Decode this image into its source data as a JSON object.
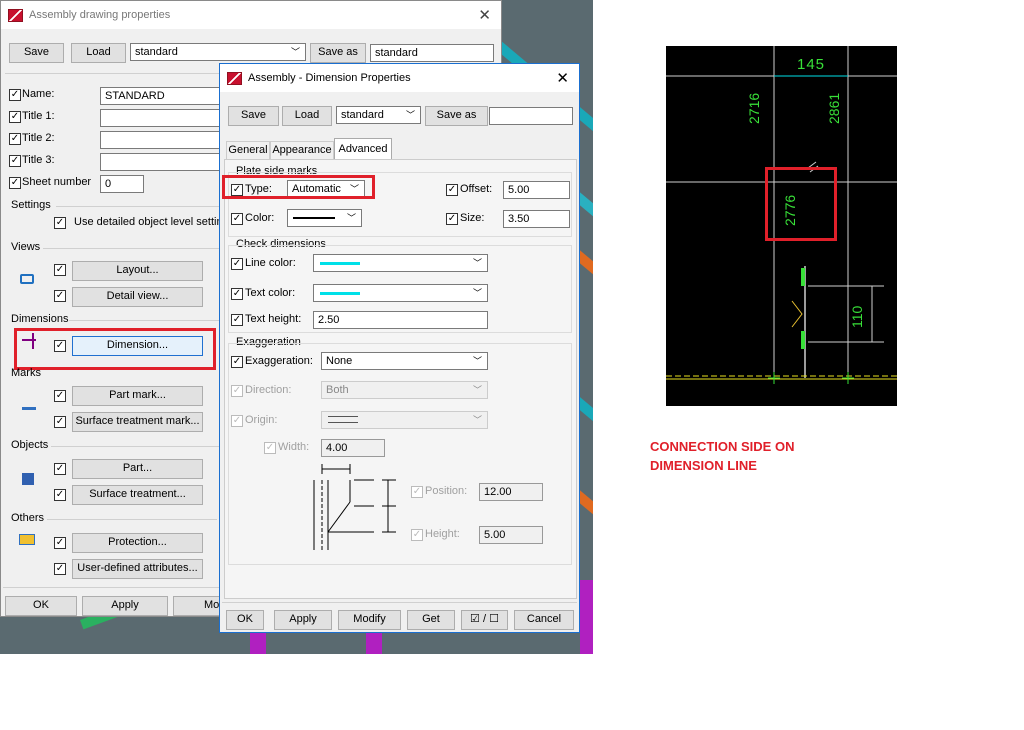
{
  "assembly_dialog": {
    "title": "Assembly drawing properties",
    "save_label": "Save",
    "load_label": "Load",
    "load_value": "standard",
    "saveas_label": "Save as",
    "saveas_value": "standard",
    "fields": [
      {
        "label": "Name:",
        "value": "STANDARD"
      },
      {
        "label": "Title 1:",
        "value": ""
      },
      {
        "label": "Title 2:",
        "value": ""
      },
      {
        "label": "Title 3:",
        "value": ""
      },
      {
        "label": "Sheet number",
        "value": "0"
      }
    ],
    "settings_heading": "Settings",
    "use_detailed_label": "Use detailed object level setting",
    "views_heading": "Views",
    "layout_btn": "Layout...",
    "detail_view_btn": "Detail view...",
    "dimensions_heading": "Dimensions",
    "dimension_btn": "Dimension...",
    "marks_heading": "Marks",
    "part_mark_btn": "Part mark...",
    "surface_treatment_mark_btn": "Surface treatment mark...",
    "objects_heading": "Objects",
    "part_btn": "Part...",
    "surface_treatment_btn": "Surface treatment...",
    "others_heading": "Others",
    "protection_btn": "Protection...",
    "user_defined_btn": "User-defined attributes...",
    "ok_label": "OK",
    "apply_label": "Apply",
    "modify_label": "Mo"
  },
  "dim_dialog": {
    "title": "Assembly - Dimension Properties",
    "save_label": "Save",
    "load_label": "Load",
    "load_value": "standard",
    "saveas_label": "Save as",
    "saveas_value": "",
    "tabs": [
      "General",
      "Appearance",
      "Advanced"
    ],
    "plate_side_marks": "Plate side marks",
    "type_label": "Type:",
    "type_value": "Automatic",
    "offset_label": "Offset:",
    "offset_value": "5.00",
    "color_label": "Color:",
    "size_label": "Size:",
    "size_value": "3.50",
    "check_dimensions": "Check dimensions",
    "line_color_label": "Line color:",
    "text_color_label": "Text color:",
    "text_height_label": "Text height:",
    "text_height_value": "2.50",
    "exaggeration_heading": "Exaggeration",
    "exaggeration_label": "Exaggeration:",
    "exaggeration_value": "None",
    "direction_label": "Direction:",
    "direction_value": "Both",
    "origin_label": "Origin:",
    "width_label": "Width:",
    "width_value": "4.00",
    "position_label": "Position:",
    "position_value": "12.00",
    "height_label": "Height:",
    "height_value": "5.00",
    "ok_label": "OK",
    "apply_label": "Apply",
    "modify_label": "Modify",
    "get_label": "Get",
    "toggle_label": "☑ / ☐",
    "cancel_label": "Cancel"
  },
  "cad": {
    "dim_145": "145",
    "dim_2716": "2716",
    "dim_2861": "2861",
    "dim_2776": "2776",
    "dim_110": "110"
  },
  "note": {
    "line1": "CONNECTION SIDE ON",
    "line2": "DIMENSION LINE"
  },
  "colors": {
    "highlight": "#e0202a",
    "dim_green": "#38e038",
    "cyan_line": "#00e0e8"
  }
}
